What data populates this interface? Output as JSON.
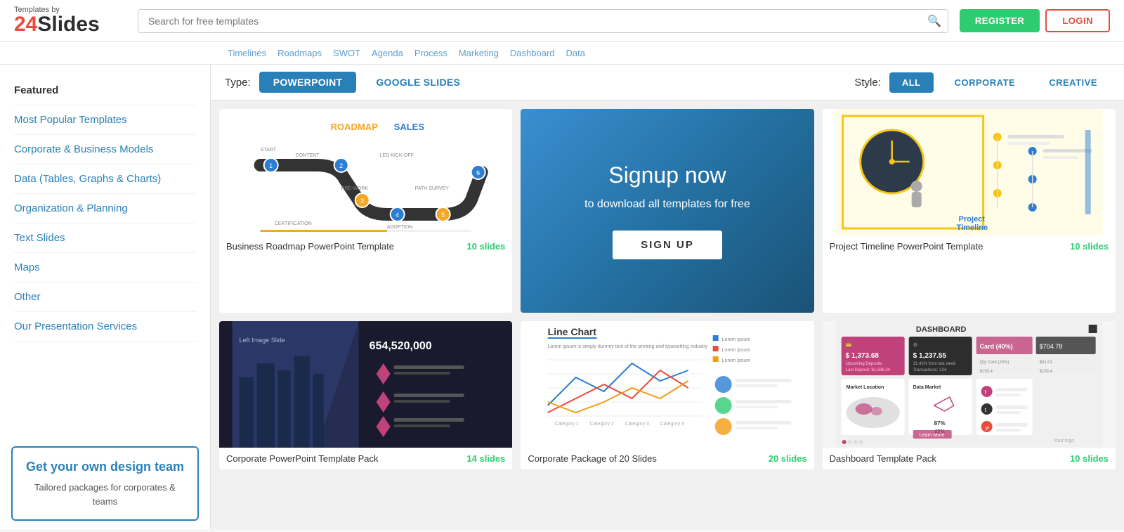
{
  "logo": {
    "by_text": "Templates by",
    "number": "24",
    "slides": "Slides"
  },
  "header": {
    "search_placeholder": "Search for free templates",
    "register_label": "REGISTER",
    "login_label": "LOGIN"
  },
  "nav_tags": [
    "Timelines",
    "Roadmaps",
    "SWOT",
    "Agenda",
    "Process",
    "Marketing",
    "Dashboard",
    "Data"
  ],
  "filter": {
    "type_label": "Type:",
    "type_options": [
      "POWERPOINT",
      "GOOGLE SLIDES"
    ],
    "active_type": "POWERPOINT",
    "style_label": "Style:",
    "style_options": [
      "ALL",
      "CORPORATE",
      "CREATIVE"
    ],
    "active_style": "ALL"
  },
  "sidebar": {
    "items": [
      {
        "label": "Featured",
        "type": "active"
      },
      {
        "label": "Most Popular Templates",
        "type": "link"
      },
      {
        "label": "Corporate & Business Models",
        "type": "link"
      },
      {
        "label": "Data (Tables, Graphs & Charts)",
        "type": "link"
      },
      {
        "label": "Organization & Planning",
        "type": "link"
      },
      {
        "label": "Text Slides",
        "type": "link"
      },
      {
        "label": "Maps",
        "type": "link"
      },
      {
        "label": "Other",
        "type": "link"
      },
      {
        "label": "Our Presentation Services",
        "type": "link"
      }
    ],
    "promo": {
      "title": "Get your own design team",
      "subtitle": "Tailored packages for corporates & teams"
    }
  },
  "templates": [
    {
      "id": "roadmap",
      "title": "Business Roadmap PowerPoint Template",
      "slides": "10 slides",
      "type": "roadmap"
    },
    {
      "id": "signup",
      "type": "signup",
      "title_line1": "Signup now",
      "subtitle": "to download all templates for free",
      "cta": "SIGN UP"
    },
    {
      "id": "timeline",
      "title": "Project Timeline PowerPoint Template",
      "slides": "10 slides",
      "type": "timeline"
    },
    {
      "id": "corporate-pack",
      "title": "Corporate PowerPoint Template Pack",
      "slides": "14 slides",
      "type": "corporate"
    },
    {
      "id": "corporate-package",
      "title": "Corporate Package of 20 Slides",
      "slides": "20 slides",
      "type": "linechart"
    },
    {
      "id": "dashboard",
      "title": "Dashboard Template Pack",
      "slides": "10 slides",
      "type": "dashboard"
    }
  ]
}
